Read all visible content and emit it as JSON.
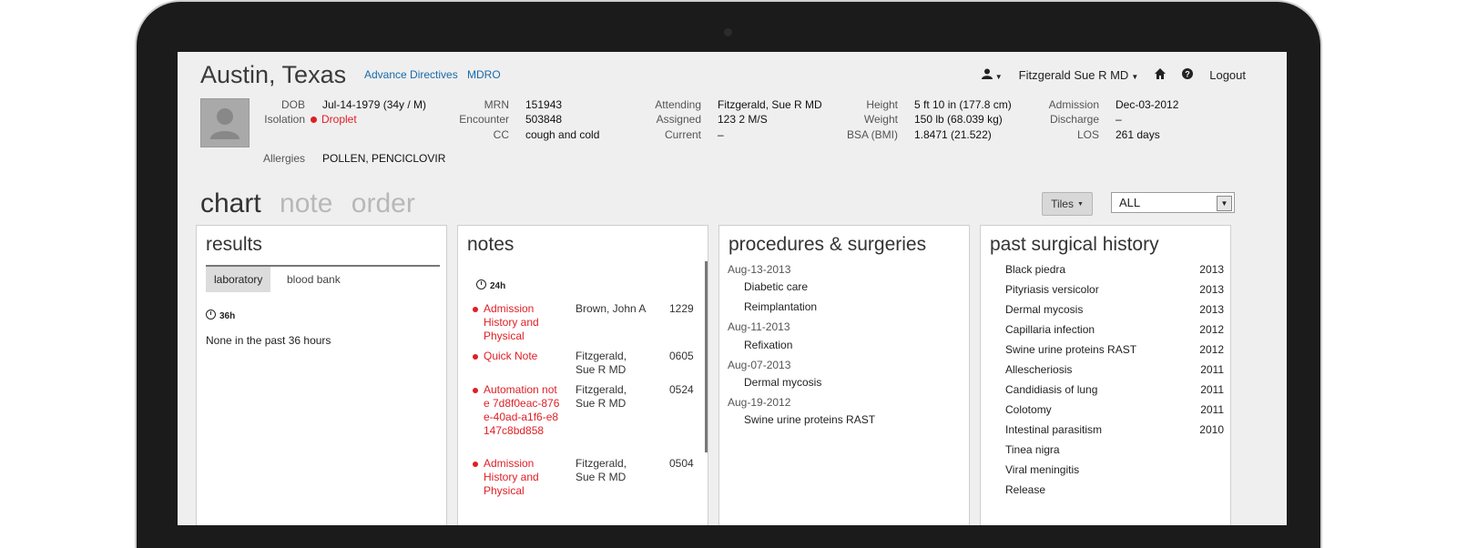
{
  "patient": {
    "name": "Austin, Texas",
    "links": [
      "Advance Directives",
      "MDRO"
    ]
  },
  "topnav": {
    "user_menu_icon": "user-icon",
    "physician": "Fitzgerald Sue R MD",
    "home_icon": "home-icon",
    "help_icon": "help-icon",
    "logout": "Logout"
  },
  "demographics": {
    "dob_label": "DOB",
    "dob": "Jul-14-1979 (34y / M)",
    "isolation_label": "Isolation",
    "isolation": "Droplet",
    "mrn_label": "MRN",
    "mrn": "151943",
    "encounter_label": "Encounter",
    "encounter": "503848",
    "cc_label": "CC",
    "cc": "cough and cold",
    "attending_label": "Attending",
    "attending": "Fitzgerald, Sue R MD",
    "assigned_label": "Assigned",
    "assigned": "123 2 M/S",
    "current_label": "Current",
    "current": "–",
    "height_label": "Height",
    "height": "5 ft 10 in (177.8 cm)",
    "weight_label": "Weight",
    "weight": "150 lb (68.039 kg)",
    "bsa_label": "BSA (BMI)",
    "bsa": "1.8471 (21.522)",
    "admission_label": "Admission",
    "admission": "Dec-03-2012",
    "discharge_label": "Discharge",
    "discharge": "–",
    "los_label": "LOS",
    "los": "261 days",
    "allergies_label": "Allergies",
    "allergies": "POLLEN, PENCICLOVIR"
  },
  "main_tabs": {
    "chart": "chart",
    "note": "note",
    "order": "order"
  },
  "controls": {
    "tiles": "Tiles",
    "filter": "ALL"
  },
  "results": {
    "title": "results",
    "tabs": [
      "laboratory",
      "blood bank"
    ],
    "time": "36h",
    "empty": "None in the past 36 hours"
  },
  "notes": {
    "title": "notes",
    "time": "24h",
    "items": [
      {
        "title": "Admission History and Physical",
        "author": "Brown, John A",
        "time": "1229"
      },
      {
        "title": "Quick Note",
        "author": "Fitzgerald, Sue R MD",
        "time": "0605"
      },
      {
        "title": "Automation note 7d8f0eac-876e-40ad-a1f6-e8147c8bd858",
        "author": "Fitzgerald, Sue R MD",
        "time": "0524"
      },
      {
        "title": "Admission History and Physical",
        "author": "Fitzgerald, Sue R MD",
        "time": "0504"
      }
    ]
  },
  "procedures": {
    "title": "procedures & surgeries",
    "groups": [
      {
        "date": "Aug-13-2013",
        "items": [
          "Diabetic care",
          "Reimplantation"
        ]
      },
      {
        "date": "Aug-11-2013",
        "items": [
          "Refixation"
        ]
      },
      {
        "date": "Aug-07-2013",
        "items": [
          "Dermal mycosis"
        ]
      },
      {
        "date": "Aug-19-2012",
        "items": [
          "Swine urine proteins RAST"
        ]
      }
    ]
  },
  "past_surgical": {
    "title": "past surgical history",
    "items": [
      {
        "name": "Black piedra",
        "year": "2013"
      },
      {
        "name": "Pityriasis versicolor",
        "year": "2013"
      },
      {
        "name": "Dermal mycosis",
        "year": "2013"
      },
      {
        "name": "Capillaria infection",
        "year": "2012"
      },
      {
        "name": "Swine urine proteins RAST",
        "year": "2012"
      },
      {
        "name": "Allescheriosis",
        "year": "2011"
      },
      {
        "name": "Candidiasis of lung",
        "year": "2011"
      },
      {
        "name": "Colotomy",
        "year": "2011"
      },
      {
        "name": "Intestinal parasitism",
        "year": "2010"
      },
      {
        "name": "Tinea nigra",
        "year": ""
      },
      {
        "name": "Viral meningitis",
        "year": ""
      },
      {
        "name": "Release",
        "year": ""
      }
    ]
  }
}
